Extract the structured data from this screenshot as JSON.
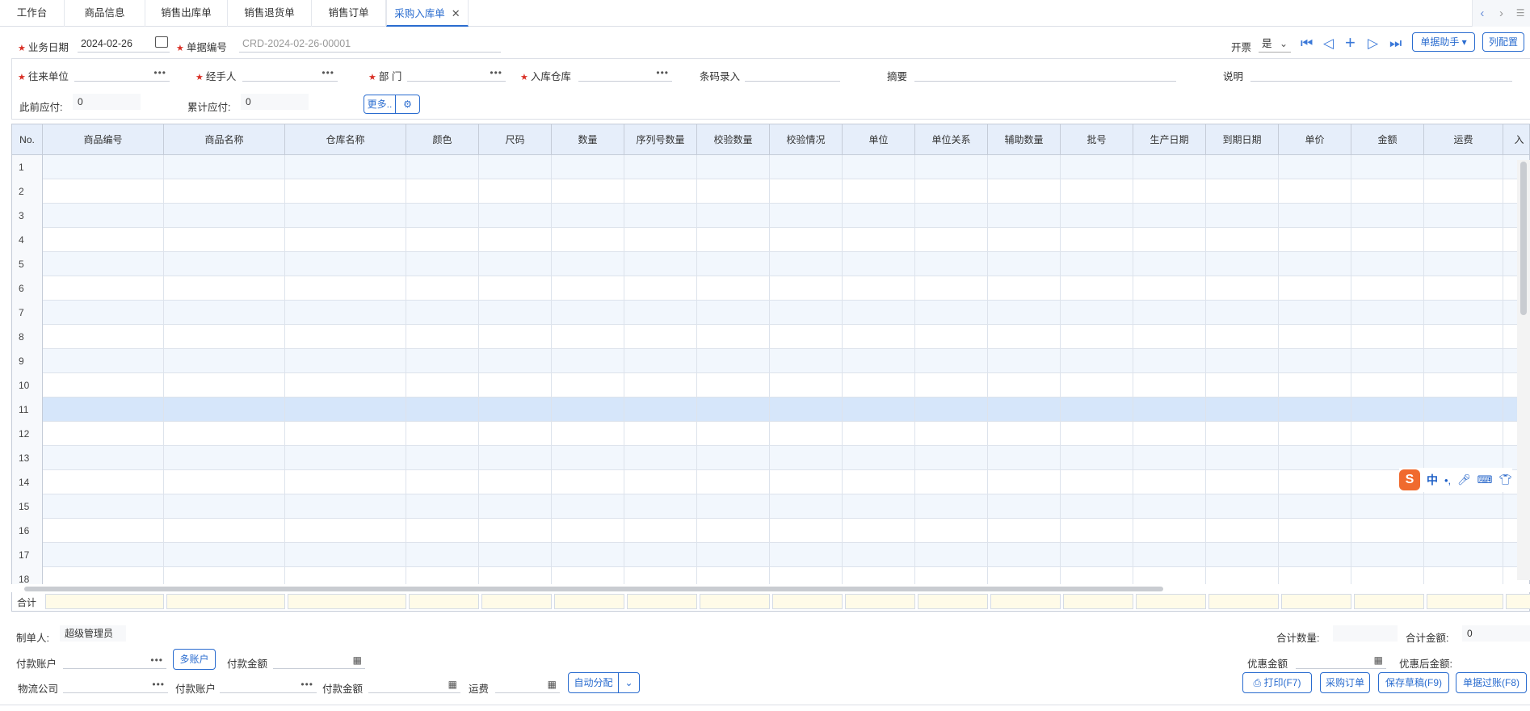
{
  "tabs": [
    "工作台",
    "商品信息",
    "销售出库单",
    "销售退货单",
    "销售订单",
    "采购入库单"
  ],
  "header": {
    "biz_date_label": "业务日期",
    "biz_date_value": "2024-02-26",
    "doc_no_label": "单据编号",
    "doc_no_placeholder": "CRD-2024-02-26-00001",
    "invoice_label": "开票",
    "invoice_value": "是",
    "assistant_btn": "单据助手 ▾",
    "columns_btn": "列配置"
  },
  "form": {
    "partner_label": "往来单位",
    "handler_label": "经手人",
    "dept_label": "部 门",
    "warehouse_label": "入库仓库",
    "barcode_label": "条码录入",
    "summary_label": "摘要",
    "remark_label": "说明",
    "prev_payable_label": "此前应付:",
    "prev_payable_value": "0",
    "total_payable_label": "累计应付:",
    "total_payable_value": "0",
    "more_btn": "更多.."
  },
  "grid": {
    "row_num_header": "No.",
    "columns": [
      "商品编号",
      "商品名称",
      "仓库名称",
      "颜色",
      "尺码",
      "数量",
      "序列号数量",
      "校验数量",
      "校验情况",
      "单位",
      "单位关系",
      "辅助数量",
      "批号",
      "生产日期",
      "到期日期",
      "单价",
      "金额",
      "运费",
      "入"
    ],
    "rows": [
      "1",
      "2",
      "3",
      "4",
      "5",
      "6",
      "7",
      "8",
      "9",
      "10",
      "11",
      "12",
      "13",
      "14",
      "15",
      "16",
      "17",
      "18"
    ],
    "total_label": "合计"
  },
  "footer": {
    "creator_label": "制单人:",
    "creator_value": "超级管理员",
    "total_qty_label": "合计数量:",
    "total_amount_label": "合计金额:",
    "total_amount_value": "0",
    "pay_account_label": "付款账户",
    "multi_account_btn": "多账户",
    "pay_amount_label": "付款金额",
    "discount_amount_label": "优惠金额",
    "after_discount_label": "优惠后金额:",
    "logistics_label": "物流公司",
    "pay_account2_label": "付款账户",
    "pay_amount2_label": "付款金额",
    "freight_label": "运费",
    "auto_allocate_btn": "自动分配",
    "print_btn": "打印(F7)",
    "purchase_order_btn": "采购订单",
    "save_draft_btn": "保存草稿(F9)",
    "post_btn": "单据过账(F8)"
  },
  "ime": {
    "lang": "中"
  }
}
